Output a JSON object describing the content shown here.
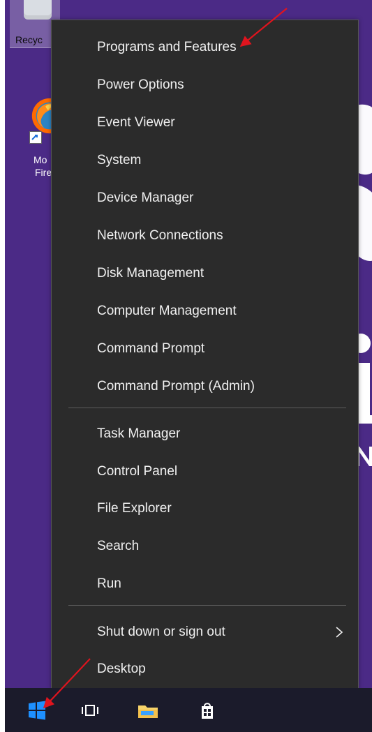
{
  "desktop": {
    "icons": {
      "recycle_bin_label": "Recyc",
      "firefox_label_line1": "Mo",
      "firefox_label_line2": "Fire"
    }
  },
  "menu": {
    "items": [
      {
        "label": "Programs and Features"
      },
      {
        "label": "Power Options"
      },
      {
        "label": "Event Viewer"
      },
      {
        "label": "System"
      },
      {
        "label": "Device Manager"
      },
      {
        "label": "Network Connections"
      },
      {
        "label": "Disk Management"
      },
      {
        "label": "Computer Management"
      },
      {
        "label": "Command Prompt"
      },
      {
        "label": "Command Prompt (Admin)"
      },
      {
        "label": "Task Manager"
      },
      {
        "label": "Control Panel"
      },
      {
        "label": "File Explorer"
      },
      {
        "label": "Search"
      },
      {
        "label": "Run"
      },
      {
        "label": "Shut down or sign out",
        "chevron_icon": "chevron-right-icon"
      },
      {
        "label": "Desktop"
      }
    ]
  },
  "taskbar": {
    "icons": [
      "windows-start-icon",
      "task-view-icon",
      "file-explorer-icon",
      "store-icon"
    ]
  },
  "colors": {
    "desktop_background": "#4b2a86",
    "menu_background": "#2b2b2b",
    "menu_text": "#f0f0f0",
    "taskbar_background": "#1b1b2b",
    "annotation_arrow": "#e0141e",
    "windows_blue": "#1e90ff"
  }
}
